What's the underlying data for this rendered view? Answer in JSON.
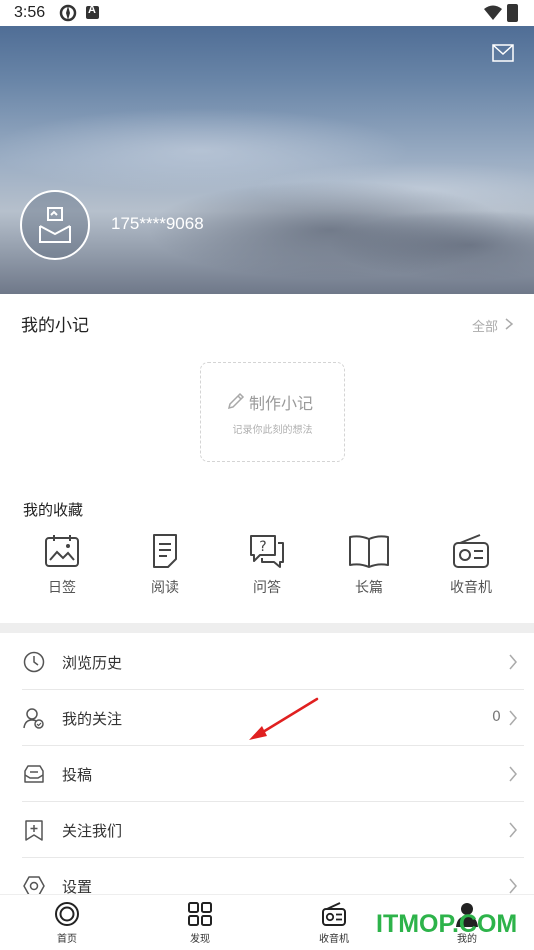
{
  "status_bar": {
    "time": "3:56"
  },
  "profile": {
    "username": "175****9068"
  },
  "notes": {
    "title": "我的小记",
    "all_label": "全部",
    "make_note_label": "制作小记",
    "make_note_hint": "记录你此刻的想法"
  },
  "favorites": {
    "title": "我的收藏",
    "items": [
      {
        "label": "日签",
        "icon": "calendar-image-icon"
      },
      {
        "label": "阅读",
        "icon": "document-icon"
      },
      {
        "label": "问答",
        "icon": "question-chat-icon"
      },
      {
        "label": "长篇",
        "icon": "open-book-icon"
      },
      {
        "label": "收音机",
        "icon": "radio-icon"
      }
    ]
  },
  "menu": [
    {
      "label": "浏览历史",
      "icon": "clock-icon",
      "count": ""
    },
    {
      "label": "我的关注",
      "icon": "user-follow-icon",
      "count": "0"
    },
    {
      "label": "投稿",
      "icon": "submit-icon",
      "count": ""
    },
    {
      "label": "关注我们",
      "icon": "bookmark-plus-icon",
      "count": ""
    },
    {
      "label": "设置",
      "icon": "settings-icon",
      "count": ""
    }
  ],
  "tabbar": {
    "items": [
      {
        "label": "首页",
        "icon": "home-circle-icon"
      },
      {
        "label": "发现",
        "icon": "grid-icon"
      },
      {
        "label": "收音机",
        "icon": "radio-icon"
      },
      {
        "label": "我的",
        "icon": "person-icon"
      }
    ]
  },
  "watermark": "ITMOP.COM",
  "colors": {
    "accent_red": "#e02020",
    "watermark_green": "#2db34a",
    "divider": "#eeeeee"
  }
}
